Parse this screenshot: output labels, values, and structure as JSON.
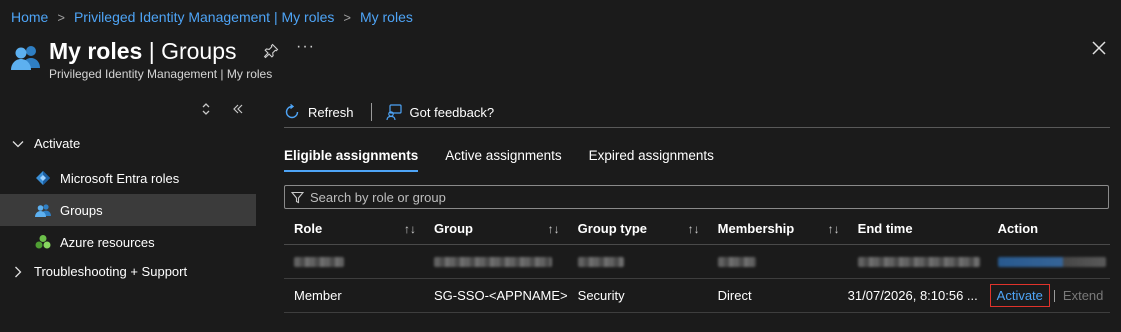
{
  "breadcrumb": [
    "Home",
    "Privileged Identity Management | My roles",
    "My roles"
  ],
  "header": {
    "title_strong": "My roles",
    "title_light": " | Groups",
    "subtitle": "Privileged Identity Management | My roles",
    "more": "···"
  },
  "sidebar": {
    "activate_label": "Activate",
    "items": [
      {
        "label": "Microsoft Entra roles",
        "icon": "entra-diamond-icon"
      },
      {
        "label": "Groups",
        "icon": "groups-people-icon"
      },
      {
        "label": "Azure resources",
        "icon": "azure-resources-icon"
      }
    ],
    "troubleshooting_label": "Troubleshooting + Support"
  },
  "toolbar": {
    "refresh_label": "Refresh",
    "feedback_label": "Got feedback?"
  },
  "tabs": [
    "Eligible assignments",
    "Active assignments",
    "Expired assignments"
  ],
  "search": {
    "placeholder": "Search by role or group"
  },
  "table": {
    "headers": [
      "Role",
      "Group",
      "Group type",
      "Membership",
      "End time",
      "Action"
    ],
    "row2": {
      "role": "Member",
      "group": "SG-SSO-<APPNAME>",
      "group_type": "Security",
      "membership": "Direct",
      "end_time": "31/07/2026, 8:10:56 ...",
      "activate": "Activate",
      "extend": "Extend"
    }
  },
  "colors": {
    "accent": "#4ea4f6",
    "highlight_border": "#e0332b",
    "background": "#1b1b1b"
  }
}
